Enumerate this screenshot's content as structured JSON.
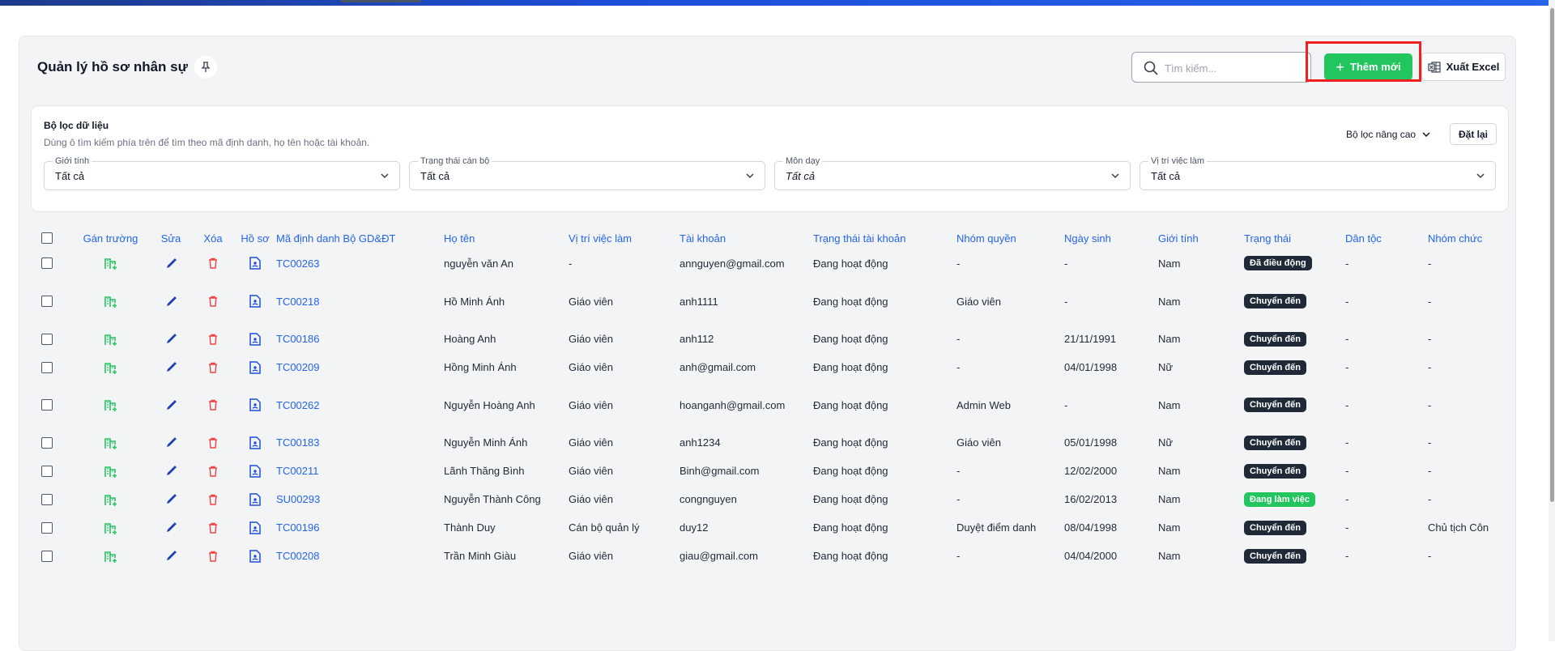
{
  "header": {
    "title": "Quản lý hồ sơ nhân sự",
    "search_placeholder": "Tìm kiếm...",
    "add_label": "Thêm mới",
    "excel_label": "Xuất Excel"
  },
  "filter": {
    "title": "Bộ lọc dữ liệu",
    "description": "Dùng ô tìm kiếm phía trên để tìm theo mã định danh, họ tên hoặc tài khoản.",
    "advanced_label": "Bộ lọc nâng cao",
    "reset_label": "Đặt lại",
    "fields": [
      {
        "label": "Giới tính",
        "value": "Tất cả"
      },
      {
        "label": "Trạng thái cán bộ",
        "value": "Tất cả"
      },
      {
        "label": "Môn dạy",
        "value": "Tất cả"
      },
      {
        "label": "Vị trí việc làm",
        "value": "Tất cả"
      }
    ]
  },
  "table": {
    "columns": [
      "Gán trường",
      "Sửa",
      "Xóa",
      "Hồ sơ",
      "Mã định danh Bộ GD&ĐT",
      "Họ tên",
      "Vị trí việc làm",
      "Tài khoản",
      "Trạng thái tài khoản",
      "Nhóm quyền",
      "Ngày sinh",
      "Giới tính",
      "Trạng thái",
      "Dân tộc",
      "Nhóm chức"
    ],
    "rows": [
      {
        "code": "TC00263",
        "name": "nguyễn văn An",
        "position": "-",
        "account": "annguyen@gmail.com",
        "account_status": "Đang hoạt động",
        "role": "-",
        "dob": "-",
        "gender": "Nam",
        "status": "Đã điều động",
        "status_color": "#1f2937",
        "ethnicity": "-",
        "group": "-"
      },
      {
        "code": "TC00218",
        "name": "Hồ Minh Ánh",
        "position": "Giáo viên",
        "account": "anh1111",
        "account_status": "Đang hoạt động",
        "role": "Giáo viên",
        "dob": "-",
        "gender": "Nam",
        "status": "Chuyển đến",
        "status_color": "#1f2937",
        "ethnicity": "-",
        "group": "-"
      },
      {
        "code": "TC00186",
        "name": "Hoàng Anh",
        "position": "Giáo viên",
        "account": "anh112",
        "account_status": "Đang hoạt động",
        "role": "-",
        "dob": "21/11/1991",
        "gender": "Nam",
        "status": "Chuyển đến",
        "status_color": "#1f2937",
        "ethnicity": "-",
        "group": "-"
      },
      {
        "code": "TC00209",
        "name": "Hồng Minh Ánh",
        "position": "Giáo viên",
        "account": "anh@gmail.com",
        "account_status": "Đang hoạt động",
        "role": "-",
        "dob": "04/01/1998",
        "gender": "Nữ",
        "status": "Chuyển đến",
        "status_color": "#1f2937",
        "ethnicity": "-",
        "group": "-"
      },
      {
        "code": "TC00262",
        "name": "Nguyễn Hoàng Anh",
        "position": "Giáo viên",
        "account": "hoanganh@gmail.com",
        "account_status": "Đang hoạt động",
        "role": "Admin Web",
        "dob": "-",
        "gender": "Nam",
        "status": "Chuyển đến",
        "status_color": "#1f2937",
        "ethnicity": "-",
        "group": "-"
      },
      {
        "code": "TC00183",
        "name": "Nguyễn Minh Ánh",
        "position": "Giáo viên",
        "account": "anh1234",
        "account_status": "Đang hoạt động",
        "role": "Giáo viên",
        "dob": "05/01/1998",
        "gender": "Nữ",
        "status": "Chuyển đến",
        "status_color": "#1f2937",
        "ethnicity": "-",
        "group": "-"
      },
      {
        "code": "TC00211",
        "name": "Lãnh Thăng Bình",
        "position": "Giáo viên",
        "account": "Binh@gmail.com",
        "account_status": "Đang hoạt động",
        "role": "-",
        "dob": "12/02/2000",
        "gender": "Nam",
        "status": "Chuyển đến",
        "status_color": "#1f2937",
        "ethnicity": "-",
        "group": "-"
      },
      {
        "code": "SU00293",
        "name": "Nguyễn Thành Công",
        "position": "Giáo viên",
        "account": "congnguyen",
        "account_status": "Đang hoạt động",
        "role": "-",
        "dob": "16/02/2013",
        "gender": "Nam",
        "status": "Đang làm việc",
        "status_color": "#22c55e",
        "ethnicity": "-",
        "group": "-"
      },
      {
        "code": "TC00196",
        "name": "Thành Duy",
        "position": "Cán bộ quản lý",
        "account": "duy12",
        "account_status": "Đang hoạt động",
        "role": "Duyệt điểm danh",
        "dob": "08/04/1998",
        "gender": "Nam",
        "status": "Chuyển đến",
        "status_color": "#1f2937",
        "ethnicity": "-",
        "group": "Chủ tịch Côn"
      },
      {
        "code": "TC00208",
        "name": "Trần Minh Giàu",
        "position": "Giáo viên",
        "account": "giau@gmail.com",
        "account_status": "Đang hoạt động",
        "role": "-",
        "dob": "04/04/2000",
        "gender": "Nam",
        "status": "Chuyển đến",
        "status_color": "#1f2937",
        "ethnicity": "-",
        "group": "-"
      }
    ]
  },
  "colors": {
    "accent": "#2563eb",
    "primary_button": "#22c55e",
    "highlight": "#ef2020",
    "assign_icon": "#22c55e",
    "edit_icon": "#1e40af",
    "delete_icon": "#ef4444",
    "profile_icon": "#1d4ed8"
  }
}
